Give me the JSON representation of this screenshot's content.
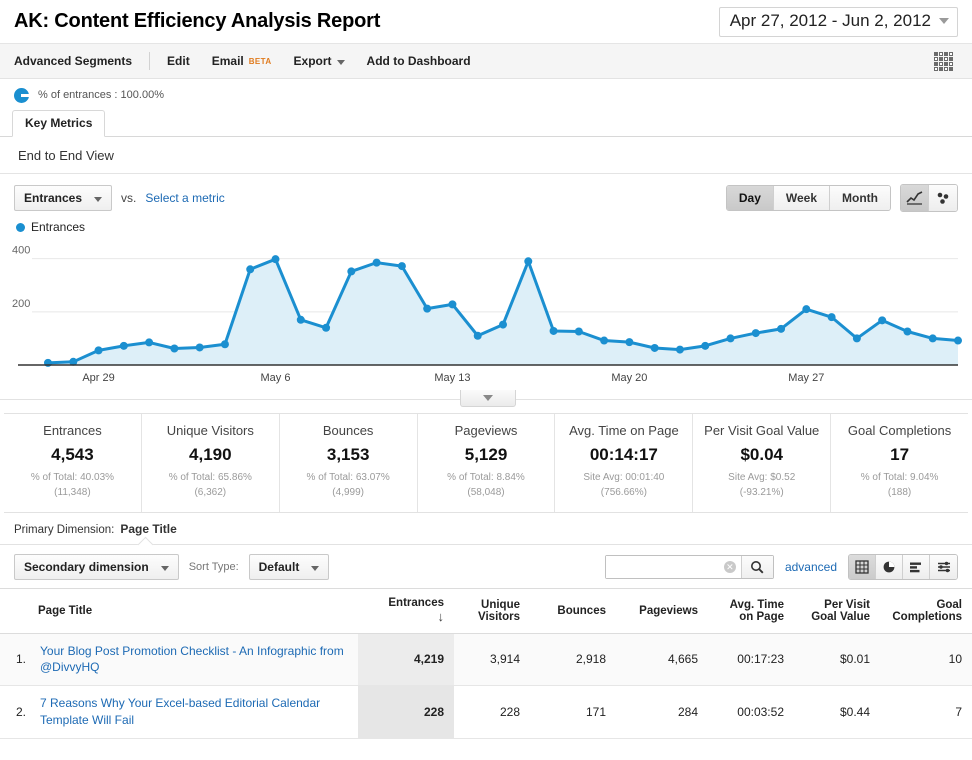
{
  "header": {
    "title": "AK: Content Efficiency Analysis Report",
    "date_range": "Apr 27, 2012 - Jun 2, 2012"
  },
  "toolbar": {
    "advanced_segments": "Advanced Segments",
    "edit": "Edit",
    "email": "Email",
    "email_badge": "BETA",
    "export": "Export",
    "add_to_dashboard": "Add to Dashboard"
  },
  "segment": {
    "label": "% of entrances : 100.00%"
  },
  "tabs": {
    "key_metrics": "Key Metrics",
    "view_label": "End to End View"
  },
  "chart_controls": {
    "metric_button": "Entrances",
    "vs": "vs.",
    "select_metric": "Select a metric",
    "granularity": [
      "Day",
      "Week",
      "Month"
    ],
    "granularity_active": "Day",
    "chart_type_icons": [
      "line-chart-icon",
      "scatter-chart-icon"
    ],
    "legend_label": "Entrances"
  },
  "chart_data": {
    "type": "area",
    "title": "Entrances",
    "xlabel": "",
    "ylabel": "Entrances",
    "ylim": [
      0,
      440
    ],
    "yticks": [
      200,
      400
    ],
    "grid": true,
    "legend": [
      "Entrances"
    ],
    "legend_position": "top-left",
    "series_color": "#1b8fd0",
    "fill_color": "#ddeff8",
    "x_tick_labels": [
      "Apr 29",
      "May 6",
      "May 13",
      "May 20",
      "May 27"
    ],
    "x_tick_indices": [
      2,
      9,
      16,
      23,
      30
    ],
    "x": [
      "Apr 27",
      "Apr 28",
      "Apr 29",
      "Apr 30",
      "May 1",
      "May 2",
      "May 3",
      "May 4",
      "May 5",
      "May 6",
      "May 7",
      "May 8",
      "May 9",
      "May 10",
      "May 11",
      "May 12",
      "May 13",
      "May 14",
      "May 15",
      "May 16",
      "May 17",
      "May 18",
      "May 19",
      "May 20",
      "May 21",
      "May 22",
      "May 23",
      "May 24",
      "May 25",
      "May 26",
      "May 27",
      "May 28",
      "May 29",
      "May 30",
      "May 31",
      "Jun 1",
      "Jun 2"
    ],
    "values": [
      8,
      12,
      55,
      72,
      85,
      62,
      66,
      78,
      360,
      398,
      170,
      140,
      352,
      385,
      372,
      212,
      228,
      110,
      152,
      390,
      128,
      126,
      92,
      86,
      64,
      58,
      72,
      100,
      120,
      136,
      210,
      180,
      100,
      168,
      126,
      100,
      92
    ]
  },
  "metric_cards": [
    {
      "name": "Entrances",
      "value": "4,543",
      "sub1": "% of Total: 40.03%",
      "sub2": "(11,348)"
    },
    {
      "name": "Unique Visitors",
      "value": "4,190",
      "sub1": "% of Total: 65.86%",
      "sub2": "(6,362)"
    },
    {
      "name": "Bounces",
      "value": "3,153",
      "sub1": "% of Total: 63.07%",
      "sub2": "(4,999)"
    },
    {
      "name": "Pageviews",
      "value": "5,129",
      "sub1": "% of Total: 8.84%",
      "sub2": "(58,048)"
    },
    {
      "name": "Avg. Time on Page",
      "value": "00:14:17",
      "sub1": "Site Avg: 00:01:40",
      "sub2": "(756.66%)"
    },
    {
      "name": "Per Visit Goal Value",
      "value": "$0.04",
      "sub1": "Site Avg: $0.52",
      "sub2": "(-93.21%)"
    },
    {
      "name": "Goal Completions",
      "value": "17",
      "sub1": "% of Total: 9.04%",
      "sub2": "(188)"
    }
  ],
  "primary_dimension": {
    "label": "Primary Dimension:",
    "value": "Page Title"
  },
  "table_controls": {
    "secondary_dimension": "Secondary dimension",
    "sort_type_label": "Sort Type:",
    "sort_type_value": "Default",
    "search_value": "",
    "search_placeholder": "",
    "advanced": "advanced",
    "view_icons": [
      "table-view-icon",
      "pie-view-icon",
      "bar-view-icon",
      "pivot-view-icon"
    ]
  },
  "table": {
    "columns": [
      "Page Title",
      "Entrances",
      "Unique Visitors",
      "Bounces",
      "Pageviews",
      "Avg. Time on Page",
      "Per Visit Goal Value",
      "Goal Completions"
    ],
    "sorted_column": "Entrances",
    "sort_direction": "descending",
    "rows": [
      {
        "index": "1.",
        "page_title": "Your Blog Post Promotion Checklist - An Infographic from @DivvyHQ",
        "entrances": "4,219",
        "unique_visitors": "3,914",
        "bounces": "2,918",
        "pageviews": "4,665",
        "avg_time_on_page": "00:17:23",
        "per_visit_goal_value": "$0.01",
        "goal_completions": "10"
      },
      {
        "index": "2.",
        "page_title": "7 Reasons Why Your Excel-based Editorial Calendar Template Will Fail",
        "entrances": "228",
        "unique_visitors": "228",
        "bounces": "171",
        "pageviews": "284",
        "avg_time_on_page": "00:03:52",
        "per_visit_goal_value": "$0.44",
        "goal_completions": "7"
      }
    ]
  }
}
